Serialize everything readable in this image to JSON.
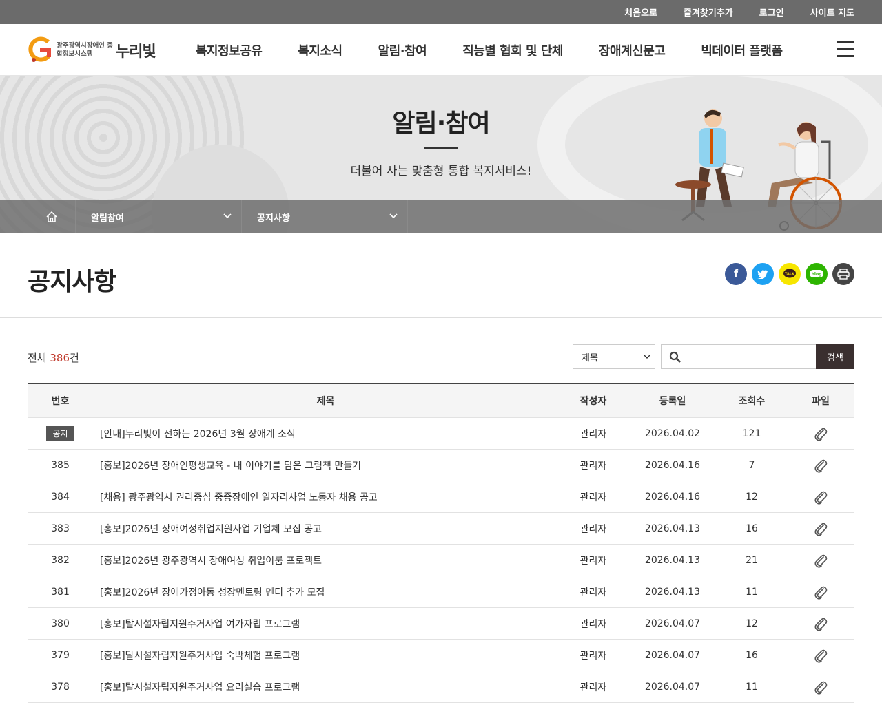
{
  "util_links": [
    "처음으로",
    "즐겨찾기추가",
    "로그인",
    "사이트 지도"
  ],
  "logo": {
    "sub": "광주광역시장애인 종합정보시스템",
    "main": "누리빛"
  },
  "gnb": [
    "복지정보공유",
    "복지소식",
    "알림·참여",
    "직능별 협회 및 단체",
    "장애계신문고",
    "빅데이터 플랫폼"
  ],
  "visual": {
    "title": "알림·참여",
    "subtitle": "더불어 사는 맞춤형 통합 복지서비스!"
  },
  "location": {
    "depth1": "알림참여",
    "depth2": "공지사항"
  },
  "page_title": "공지사항",
  "share_icons": [
    "facebook-icon",
    "twitter-icon",
    "kakaotalk-icon",
    "blog-icon",
    "print-icon"
  ],
  "board": {
    "total_prefix": "전체 ",
    "total_count": "386",
    "total_suffix": "건",
    "search_select": "제목",
    "search_placeholder": "",
    "search_button": "검색",
    "headers": {
      "no": "번호",
      "title": "제목",
      "writer": "작성자",
      "date": "등록일",
      "views": "조회수",
      "file": "파일"
    },
    "notice_badge": "공지",
    "rows": [
      {
        "no": "공지",
        "title": "[안내]누리빛이 전하는 2026년 3월 장애계 소식",
        "writer": "관리자",
        "date": "2026.04.02",
        "views": "121"
      },
      {
        "no": "385",
        "title": "[홍보]2026년 장애인평생교육 - 내 이야기를 담은 그림책 만들기",
        "writer": "관리자",
        "date": "2026.04.16",
        "views": "7"
      },
      {
        "no": "384",
        "title": "[채용] 광주광역시 권리중심 중증장애인 일자리사업 노동자 채용 공고",
        "writer": "관리자",
        "date": "2026.04.16",
        "views": "12"
      },
      {
        "no": "383",
        "title": "[홍보]2026년 장애여성취업지원사업 기업체 모집 공고",
        "writer": "관리자",
        "date": "2026.04.13",
        "views": "16"
      },
      {
        "no": "382",
        "title": "[홍보]2026년 광주광역시 장애여성 취업이룸 프로젝트",
        "writer": "관리자",
        "date": "2026.04.13",
        "views": "21"
      },
      {
        "no": "381",
        "title": "[홍보]2026년 장애가정아동 성장멘토링 멘티 추가 모집",
        "writer": "관리자",
        "date": "2026.04.13",
        "views": "11"
      },
      {
        "no": "380",
        "title": "[홍보]탈시설자립지원주거사업 여가자립 프로그램",
        "writer": "관리자",
        "date": "2026.04.07",
        "views": "12"
      },
      {
        "no": "379",
        "title": "[홍보]탈시설자립지원주거사업 숙박체험 프로그램",
        "writer": "관리자",
        "date": "2026.04.07",
        "views": "16"
      },
      {
        "no": "378",
        "title": "[홍보]탈시설자립지원주거사업 요리실습 프로그램",
        "writer": "관리자",
        "date": "2026.04.07",
        "views": "11"
      }
    ]
  }
}
